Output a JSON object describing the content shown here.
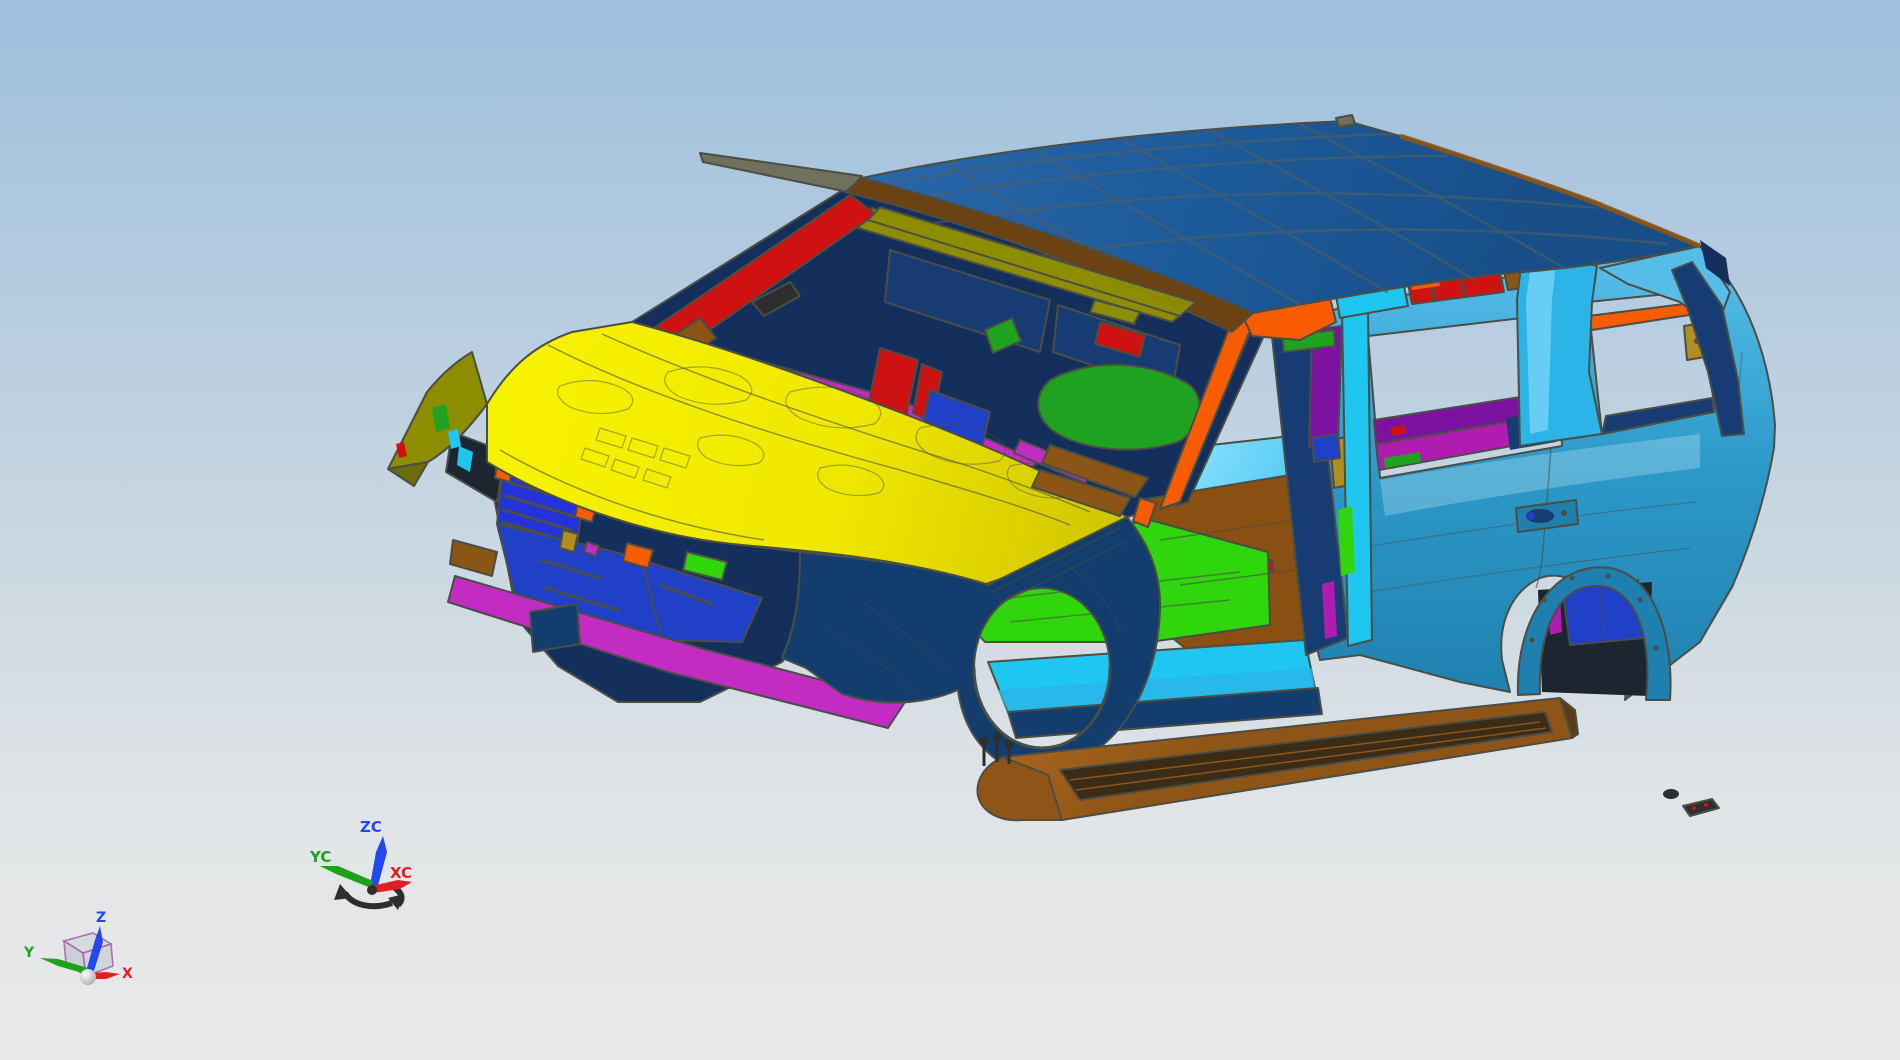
{
  "viewport": {
    "type": "cad-3d-shaded-view",
    "subject": "SUV body-in-white sheet metal assembly, isometric front-left view"
  },
  "triads": {
    "wcs": {
      "x_label": "XC",
      "y_label": "YC",
      "z_label": "ZC"
    },
    "absolute": {
      "x_label": "X",
      "y_label": "Y",
      "z_label": "Z"
    }
  },
  "colors": {
    "bg_top": "#9dbfdd",
    "bg_mid": "#cdd9e2",
    "bg_low": "#e2e5e7",
    "bg_bottom": "#e9e9e9",
    "outline": "#4a4e45",
    "roof_light": "#2766aa",
    "roof": "#1d5a99",
    "roof_dark": "#174e88",
    "roof_grid": "#55605c",
    "header_brown": "#6b4212",
    "trim_brown": "#8a5515",
    "gray_trim": "#70705c",
    "hood_light": "#f7f300",
    "hood": "#efe800",
    "hood_shade": "#cfc400",
    "olive": "#8d8d00",
    "olive_dark": "#6d6d08",
    "fender_navy": "#123d6d",
    "dash_navy": "#173c74",
    "interior_navy": "#142f5c",
    "grille_blue": "#2233da",
    "royal_blue": "#2140c8",
    "magenta": "#c22cc2",
    "purple": "#7d12a1",
    "beltline_magenta": "#b01bb0",
    "red": "#ce1212",
    "orange": "#f85c00",
    "green_floor": "#2fd60c",
    "seat_green": "#1fa21f",
    "cyan": "#1ec6f0",
    "floor_cyan_light": "#8ce4ff",
    "floor_cyan": "#2bb4e8",
    "side_light": "#55bde8",
    "side": "#2d9aca",
    "side_dark": "#1f7fae",
    "brown_floor": "#8a5012",
    "board_light": "#b06a20",
    "board": "#8f5516",
    "board_dark": "#5a3c16",
    "board_inset": "#3a2c16",
    "khaki": "#b08f20",
    "wheel_dark": "#1d2530",
    "dark_part": "#2e2e2e",
    "tri_red": "#e02020",
    "tri_green": "#1ea21e",
    "tri_blue": "#2448f0",
    "cube_purple": "#a965a9",
    "sphere_light": "#ffffff",
    "sphere_dark": "#9aa0a6"
  },
  "parts": [
    {
      "name": "roof-panel",
      "color": "roof"
    },
    {
      "name": "windshield-header",
      "color": "header_brown"
    },
    {
      "name": "hood-outer-panel",
      "color": "hood"
    },
    {
      "name": "fender-left-edge",
      "color": "olive"
    },
    {
      "name": "front-fender",
      "color": "fender_navy"
    },
    {
      "name": "grille-reinforcement",
      "color": "grille_blue"
    },
    {
      "name": "bumper-beam",
      "color": "royal_blue"
    },
    {
      "name": "bumper-lower-bar",
      "color": "magenta"
    },
    {
      "name": "a-pillar-outer",
      "color": "orange"
    },
    {
      "name": "cowl-vent-panel",
      "color": "magenta"
    },
    {
      "name": "dash-panel",
      "color": "dash_navy"
    },
    {
      "name": "front-seat-trim",
      "color": "seat_green"
    },
    {
      "name": "front-floor-pan",
      "color": "green_floor"
    },
    {
      "name": "floor-tunnel",
      "color": "floor_cyan"
    },
    {
      "name": "center-floor-pan",
      "color": "brown_floor"
    },
    {
      "name": "rocker-inner",
      "color": "cyan"
    },
    {
      "name": "b-pillar-inner",
      "color": "dash_navy"
    },
    {
      "name": "c-pillar-outer",
      "color": "cyan"
    },
    {
      "name": "bodyside-outer-panel",
      "color": "side"
    },
    {
      "name": "beltline-rail-upper",
      "color": "purple"
    },
    {
      "name": "beltline-rail-lower",
      "color": "beltline_magenta"
    },
    {
      "name": "quarter-window-bracket",
      "color": "orange"
    },
    {
      "name": "roof-rail-bracket",
      "color": "red"
    },
    {
      "name": "rear-wheelhouse",
      "color": "royal_blue"
    },
    {
      "name": "running-board",
      "color": "board"
    },
    {
      "name": "d-pillar-inner",
      "color": "dash_navy"
    }
  ]
}
